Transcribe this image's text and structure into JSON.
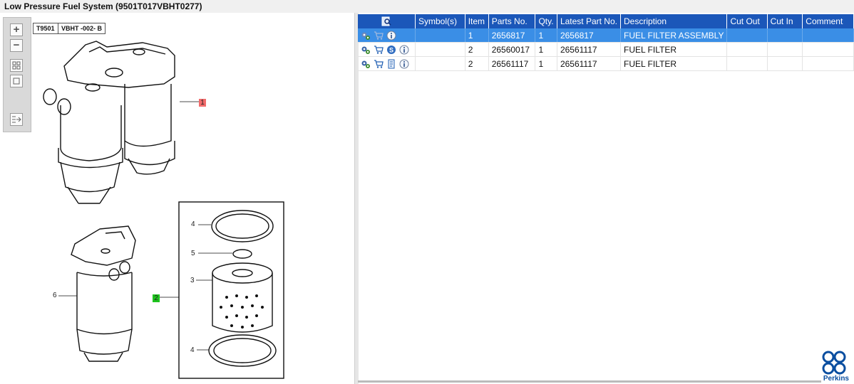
{
  "window": {
    "title": "Low Pressure Fuel System (9501T017VBHT0277)"
  },
  "toolbar": {
    "zoom_in": "+",
    "zoom_out": "−"
  },
  "drawing": {
    "tag_ref": "T9501",
    "tag_code": "VBHT -002- B",
    "markers": {
      "m1": "1",
      "m2": "2"
    },
    "callouts": {
      "c4a": "4",
      "c5": "5",
      "c3": "3",
      "c6": "6",
      "c4b": "4"
    },
    "colors": {
      "marker1": "#f26b6b",
      "marker2": "#1ec41e"
    }
  },
  "grid": {
    "headers": [
      "Symbol(s)",
      "Item",
      "Parts No.",
      "Qty.",
      "Latest Part No.",
      "Description",
      "Cut Out",
      "Cut In",
      "Comment"
    ],
    "rows": [
      {
        "item": "1",
        "part_no": "2656817",
        "qty": "1",
        "latest": "2656817",
        "description": "FUEL FILTER ASSEMBLY",
        "cut_out": "",
        "cut_in": "",
        "comment": ""
      },
      {
        "item": "2",
        "part_no": "26560017",
        "qty": "1",
        "latest": "26561117",
        "description": "FUEL FILTER",
        "cut_out": "",
        "cut_in": "",
        "comment": ""
      },
      {
        "item": "2",
        "part_no": "26561117",
        "qty": "1",
        "latest": "26561117",
        "description": "FUEL FILTER",
        "cut_out": "",
        "cut_in": "",
        "comment": ""
      }
    ],
    "colors": {
      "header": "#1b57b9",
      "selected": "#3a8ee6"
    }
  },
  "brand": {
    "logo_text": "Perkins"
  }
}
